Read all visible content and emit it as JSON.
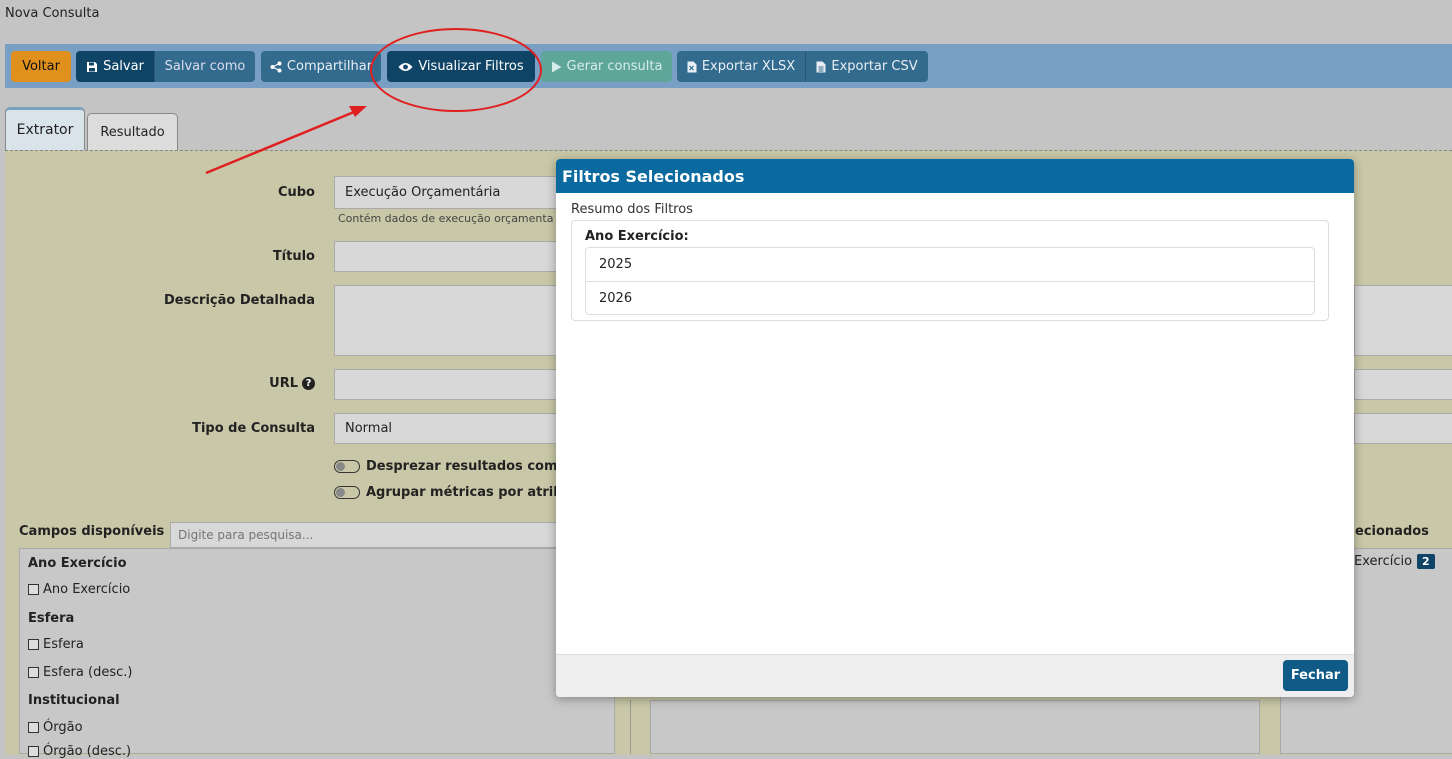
{
  "page": {
    "title": "Nova Consulta"
  },
  "toolbar": {
    "back_label": "Voltar",
    "save_label": "Salvar",
    "save_as_label": "Salvar como",
    "share_label": "Compartilhar",
    "view_filters_label": "Visualizar Filtros",
    "generate_label": "Gerar consulta",
    "export_xlsx_label": "Exportar XLSX",
    "export_csv_label": "Exportar CSV"
  },
  "tabs": {
    "extractor": "Extrator",
    "result": "Resultado"
  },
  "form": {
    "cube_label": "Cubo",
    "cube_value": "Execução Orçamentária",
    "cube_hint": "Contém dados de execução orçamenta",
    "title_label": "Título",
    "description_label": "Descrição Detalhada",
    "url_label": "URL",
    "query_type_label": "Tipo de Consulta",
    "query_type_value": "Normal",
    "toggle_1": "Desprezar resultados com",
    "toggle_2": "Agrupar métricas por atril"
  },
  "fields": {
    "label": "Campos disponíveis",
    "search_placeholder": "Digite para pesquisa...",
    "groups": [
      {
        "name": "Ano Exercício",
        "items": [
          "Ano Exercício"
        ]
      },
      {
        "name": "Esfera",
        "items": [
          "Esfera",
          "Esfera (desc.)"
        ]
      },
      {
        "name": "Institucional",
        "items": [
          "Órgão",
          "Órgão (desc.)"
        ]
      }
    ]
  },
  "selected": {
    "label": "ecionados",
    "item": "Exercício",
    "count": "2"
  },
  "modal": {
    "title": "Filtros Selecionados",
    "subtitle": "Resumo dos Filtros",
    "filter_name": "Ano Exercício:",
    "values": [
      "2025",
      "2026"
    ],
    "close_label": "Fechar"
  }
}
